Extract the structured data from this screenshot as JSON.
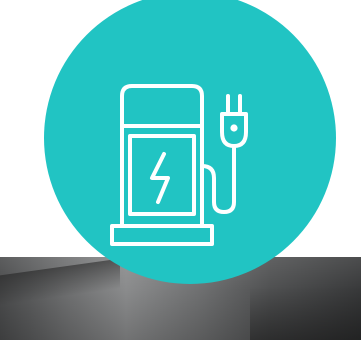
{
  "badge": {
    "accent_color": "#21c4c3",
    "icon": "ev-charging-station-icon",
    "icon_stroke_color": "#ffffff"
  },
  "background": {
    "photo": "blurred-photo-strip"
  }
}
